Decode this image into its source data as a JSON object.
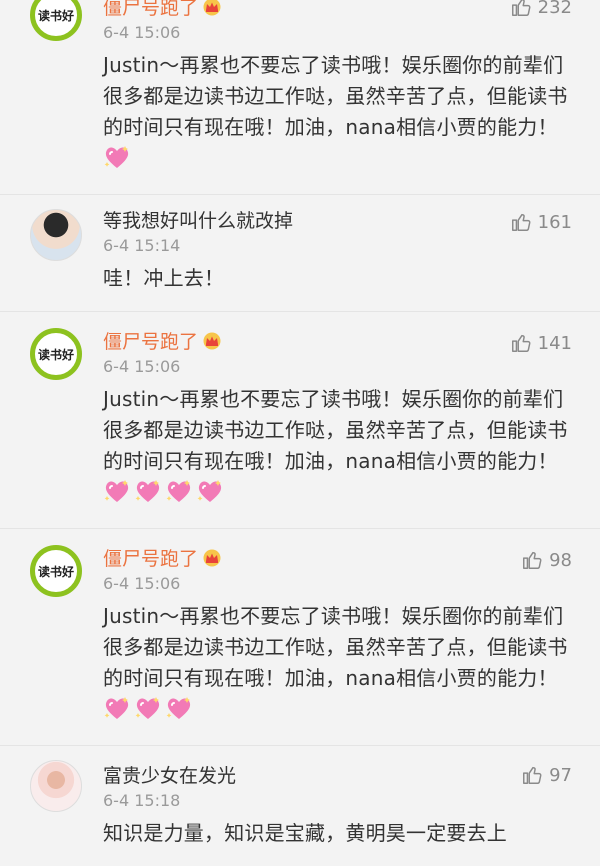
{
  "avatar_text": "读书好",
  "comments": [
    {
      "author": "僵尸号跑了",
      "time": "6-4 15:06",
      "likes": "232",
      "text": "Justin～再累也不要忘了读书哦！娱乐圈你的前辈们很多都是边读书边工作哒，虽然辛苦了点，但能读书的时间只有现在哦！加油，nana相信小贾的能力！",
      "hearts": 1
    },
    {
      "author": "等我想好叫什么就改掉",
      "time": "6-4 15:14",
      "likes": "161",
      "text": "哇！冲上去！"
    },
    {
      "author": "僵尸号跑了",
      "time": "6-4 15:06",
      "likes": "141",
      "text": "Justin～再累也不要忘了读书哦！娱乐圈你的前辈们很多都是边读书边工作哒，虽然辛苦了点，但能读书的时间只有现在哦！加油，nana相信小贾的能力！",
      "hearts": 4
    },
    {
      "author": "僵尸号跑了",
      "time": "6-4 15:06",
      "likes": "98",
      "text": "Justin～再累也不要忘了读书哦！娱乐圈你的前辈们很多都是边读书边工作哒，虽然辛苦了点，但能读书的时间只有现在哦！加油，nana相信小贾的能力！",
      "hearts": 3
    },
    {
      "author": "富贵少女在发光",
      "time": "6-4 15:18",
      "likes": "97",
      "text": "知识是力量，知识是宝藏，黄明昊一定要去上"
    }
  ],
  "icons": {
    "like": "thumbs-up-icon",
    "crown": "crown-icon",
    "heart": "sparkling-heart-icon"
  },
  "colors": {
    "vip_name": "#eb7340",
    "avatar_ring": "#8dc21f",
    "heart": "#f27ab6"
  }
}
